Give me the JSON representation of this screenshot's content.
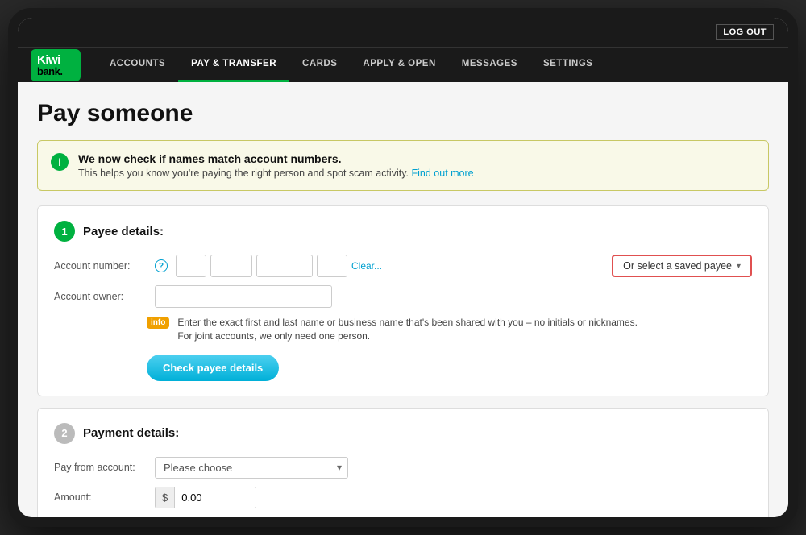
{
  "topbar": {
    "logout_label": "LOG OUT"
  },
  "nav": {
    "logo_kiwi": "Kiwi",
    "logo_bank": "bank.",
    "items": [
      {
        "label": "ACCOUNTS",
        "active": false
      },
      {
        "label": "PAY & TRANSFER",
        "active": true
      },
      {
        "label": "CARDS",
        "active": false
      },
      {
        "label": "APPLY & OPEN",
        "active": false
      },
      {
        "label": "MESSAGES",
        "active": false
      },
      {
        "label": "SETTINGS",
        "active": false
      }
    ]
  },
  "page": {
    "title": "Pay someone",
    "info_banner": {
      "heading": "We now check if names match account numbers.",
      "body": "This helps you know you're paying the right person and spot scam activity.",
      "link_text": "Find out more"
    }
  },
  "payee_section": {
    "step": "1",
    "title": "Payee details:",
    "account_number_label": "Account number:",
    "help_icon": "?",
    "clear_link": "Clear...",
    "saved_payee_btn": "Or select a saved payee",
    "account_owner_label": "Account owner:",
    "info_badge": "info",
    "info_text": "Enter the exact first and last name or business name that's been shared with you – no initials or nicknames.\nFor joint accounts, we only need one person.",
    "check_payee_btn": "Check payee details",
    "acct_placeholder_1": "",
    "acct_placeholder_2": "",
    "acct_placeholder_3": "",
    "acct_placeholder_4": ""
  },
  "payment_section": {
    "step": "2",
    "title": "Payment details:",
    "pay_from_label": "Pay from account:",
    "pay_from_placeholder": "Please choose",
    "amount_label": "Amount:",
    "amount_currency": "$",
    "amount_value": "0.00"
  }
}
